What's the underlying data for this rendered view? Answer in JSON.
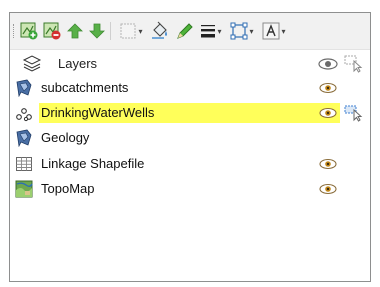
{
  "toolbar": {
    "buttons": [
      {
        "name": "add-layer-button",
        "icon": "add-layer-icon"
      },
      {
        "name": "remove-layer-button",
        "icon": "remove-layer-icon"
      },
      {
        "name": "move-layer-up-button",
        "icon": "arrow-up-icon"
      },
      {
        "name": "move-layer-down-button",
        "icon": "arrow-down-icon"
      },
      {
        "name": "layer-properties-button",
        "icon": "properties-icon"
      },
      {
        "name": "fill-color-button",
        "icon": "paint-bucket-icon"
      },
      {
        "name": "outline-color-button",
        "icon": "pencil-icon"
      },
      {
        "name": "line-width-button",
        "icon": "line-width-icon"
      },
      {
        "name": "select-extent-button",
        "icon": "extent-icon"
      },
      {
        "name": "label-button",
        "icon": "label-icon"
      }
    ]
  },
  "panel": {
    "title": "Layers",
    "header_icons": [
      "layers-stack-icon",
      "eye-icon",
      "edit-cursor-icon"
    ]
  },
  "layers": [
    {
      "name": "subcatchments",
      "icon": "polygon-layer-icon",
      "visible": true,
      "selected": false,
      "editing": false
    },
    {
      "name": "DrinkingWaterWells",
      "icon": "point-layer-icon",
      "visible": true,
      "selected": true,
      "editing": true
    },
    {
      "name": "Geology",
      "icon": "polygon-layer-icon",
      "visible": false,
      "selected": false,
      "editing": false
    },
    {
      "name": "Linkage Shapefile",
      "icon": "table-layer-icon",
      "visible": true,
      "selected": false,
      "editing": false
    },
    {
      "name": "TopoMap",
      "icon": "raster-layer-icon",
      "visible": true,
      "selected": false,
      "editing": false
    }
  ],
  "colors": {
    "selection_highlight": "#ffff5a",
    "add_green": "#3aa63a",
    "remove_red": "#d43030",
    "arrow_green": "#58b048",
    "eye": "#6b6b6b"
  }
}
